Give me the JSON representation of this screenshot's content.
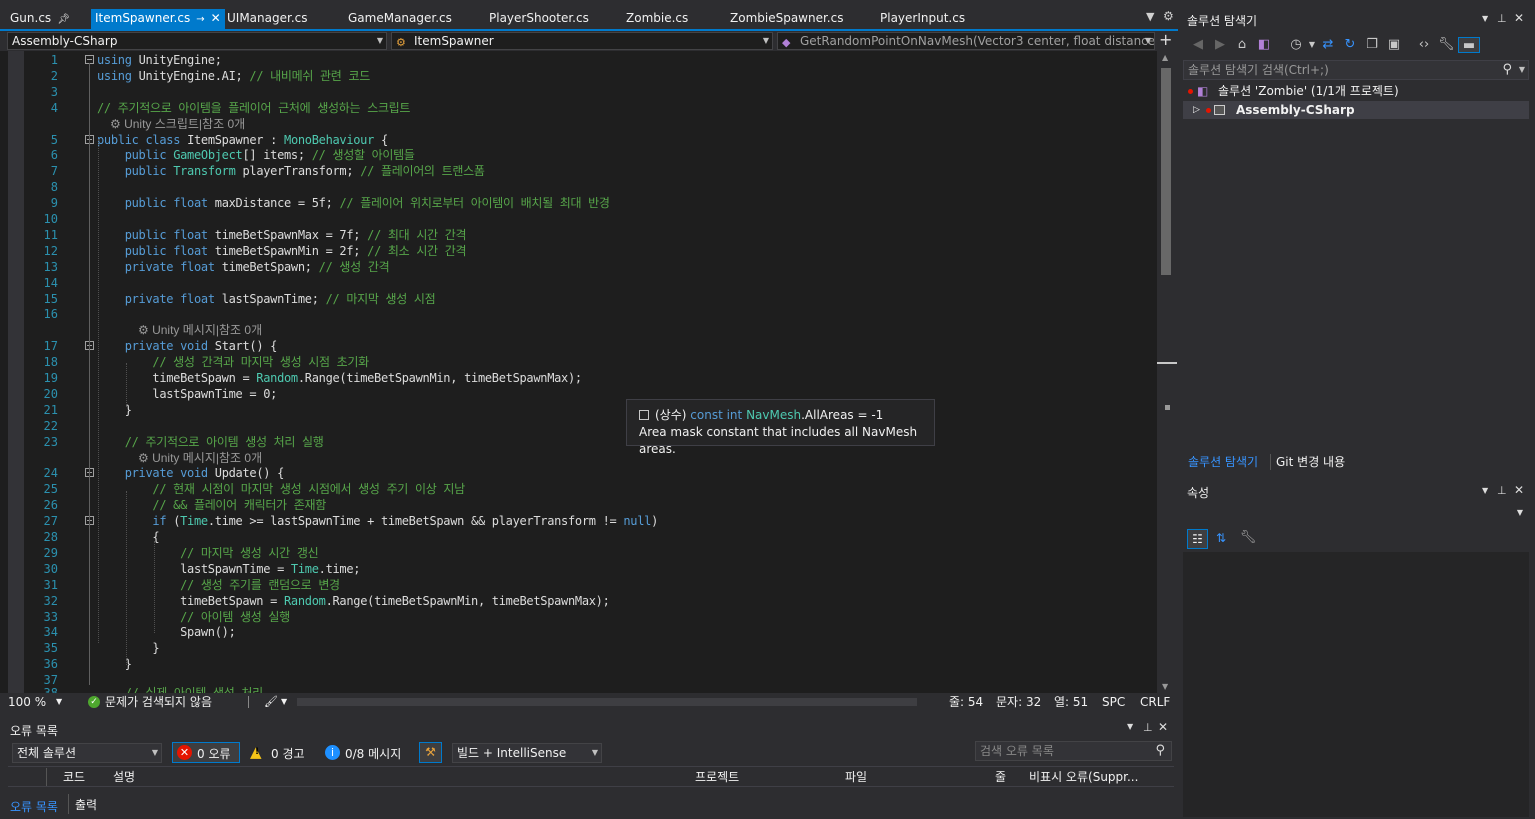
{
  "tabs": [
    {
      "label": "Gun.cs",
      "pinned": true
    },
    {
      "label": "ItemSpawner.cs",
      "active": true
    },
    {
      "label": "UIManager.cs"
    },
    {
      "label": "GameManager.cs"
    },
    {
      "label": "PlayerShooter.cs"
    },
    {
      "label": "Zombie.cs"
    },
    {
      "label": "ZombieSpawner.cs"
    },
    {
      "label": "PlayerInput.cs"
    }
  ],
  "nav": {
    "project": "Assembly-CSharp",
    "class": "ItemSpawner",
    "member": "GetRandomPointOnNavMesh(Vector3 center, float distance)"
  },
  "code_lines": [
    {
      "n": "1",
      "code": "using UnityEngine;"
    },
    {
      "n": "2",
      "code": "using UnityEngine.AI; // 내비메쉬 관련 코드"
    },
    {
      "n": "3",
      "code": ""
    },
    {
      "n": "4",
      "code": "// 주기적으로 아이템을 플레이어 근처에 생성하는 스크립트"
    },
    {
      "lens": "Unity 스크립트|참조 0개"
    },
    {
      "n": "5",
      "code": "public class ItemSpawner : MonoBehaviour {"
    },
    {
      "n": "6",
      "code": "    public GameObject[] items; // 생성할 아이템들"
    },
    {
      "n": "7",
      "code": "    public Transform playerTransform; // 플레이어의 트랜스폼"
    },
    {
      "n": "8",
      "code": ""
    },
    {
      "n": "9",
      "code": "    public float maxDistance = 5f; // 플레이어 위치로부터 아이템이 배치될 최대 반경"
    },
    {
      "n": "10",
      "code": ""
    },
    {
      "n": "11",
      "code": "    public float timeBetSpawnMax = 7f; // 최대 시간 간격"
    },
    {
      "n": "12",
      "code": "    public float timeBetSpawnMin = 2f; // 최소 시간 간격"
    },
    {
      "n": "13",
      "code": "    private float timeBetSpawn; // 생성 간격"
    },
    {
      "n": "14",
      "code": ""
    },
    {
      "n": "15",
      "code": "    private float lastSpawnTime; // 마지막 생성 시점"
    },
    {
      "n": "16",
      "code": ""
    },
    {
      "lens": "Unity 메시지|참조 0개"
    },
    {
      "n": "17",
      "code": "    private void Start() {"
    },
    {
      "n": "18",
      "code": "        // 생성 간격과 마지막 생성 시점 초기화"
    },
    {
      "n": "19",
      "code": "        timeBetSpawn = Random.Range(timeBetSpawnMin, timeBetSpawnMax);"
    },
    {
      "n": "20",
      "code": "        lastSpawnTime = 0;"
    },
    {
      "n": "21",
      "code": "    }"
    },
    {
      "n": "22",
      "code": ""
    },
    {
      "n": "23",
      "code": "    // 주기적으로 아이템 생성 처리 실행"
    },
    {
      "lens": "Unity 메시지|참조 0개"
    },
    {
      "n": "24",
      "code": "    private void Update() {"
    },
    {
      "n": "25",
      "code": "        // 현재 시점이 마지막 생성 시점에서 생성 주기 이상 지남"
    },
    {
      "n": "26",
      "code": "        // && 플레이어 캐릭터가 존재함"
    },
    {
      "n": "27",
      "code": "        if (Time.time >= lastSpawnTime + timeBetSpawn && playerTransform != null)"
    },
    {
      "n": "28",
      "code": "        {"
    },
    {
      "n": "29",
      "code": "            // 마지막 생성 시간 갱신"
    },
    {
      "n": "30",
      "code": "            lastSpawnTime = Time.time;"
    },
    {
      "n": "31",
      "code": "            // 생성 주기를 랜덤으로 변경"
    },
    {
      "n": "32",
      "code": "            timeBetSpawn = Random.Range(timeBetSpawnMin, timeBetSpawnMax);"
    },
    {
      "n": "33",
      "code": "            // 아이템 생성 실행"
    },
    {
      "n": "34",
      "code": "            Spawn();"
    },
    {
      "n": "35",
      "code": "        }"
    },
    {
      "n": "36",
      "code": "    }"
    },
    {
      "n": "37",
      "code": ""
    }
  ],
  "tooltip": {
    "prefix": "(상수)",
    "decl_kw": "const int",
    "decl_type": "NavMesh",
    "decl_rest": ".AllAreas = -1",
    "description": "Area mask constant that includes all NavMesh areas."
  },
  "status": {
    "zoom": "100 %",
    "issues": "문제가 검색되지 않음",
    "line": "줄: 54",
    "char": "문자: 32",
    "col": "열: 51",
    "spc": "SPC",
    "crlf": "CRLF"
  },
  "error_list": {
    "title": "오류 목록",
    "scope": "전체 솔루션",
    "errors": "0 오류",
    "warnings": "0 경고",
    "messages": "0/8 메시지",
    "build_filter": "빌드 + IntelliSense",
    "search_placeholder": "검색 오류 목록",
    "columns": [
      "코드",
      "설명",
      "프로젝트",
      "파일",
      "줄",
      "비표시 오류(Suppr..."
    ],
    "bottom_tabs": [
      "오류 목록",
      "출력"
    ]
  },
  "solution_explorer": {
    "title": "솔루션 탐색기",
    "search_placeholder": "솔루션 탐색기 검색(Ctrl+;)",
    "solution": "솔루션 'Zombie' (1/1개 프로젝트)",
    "project": "Assembly-CSharp",
    "bottom_tabs": [
      "솔루션 탐색기",
      "Git 변경 내용"
    ]
  },
  "properties": {
    "title": "속성"
  },
  "colors": {
    "accent": "#007acc",
    "keyword": "#569cd6",
    "type": "#4ec9b0",
    "comment": "#57a64a",
    "linenum": "#2b91af"
  }
}
